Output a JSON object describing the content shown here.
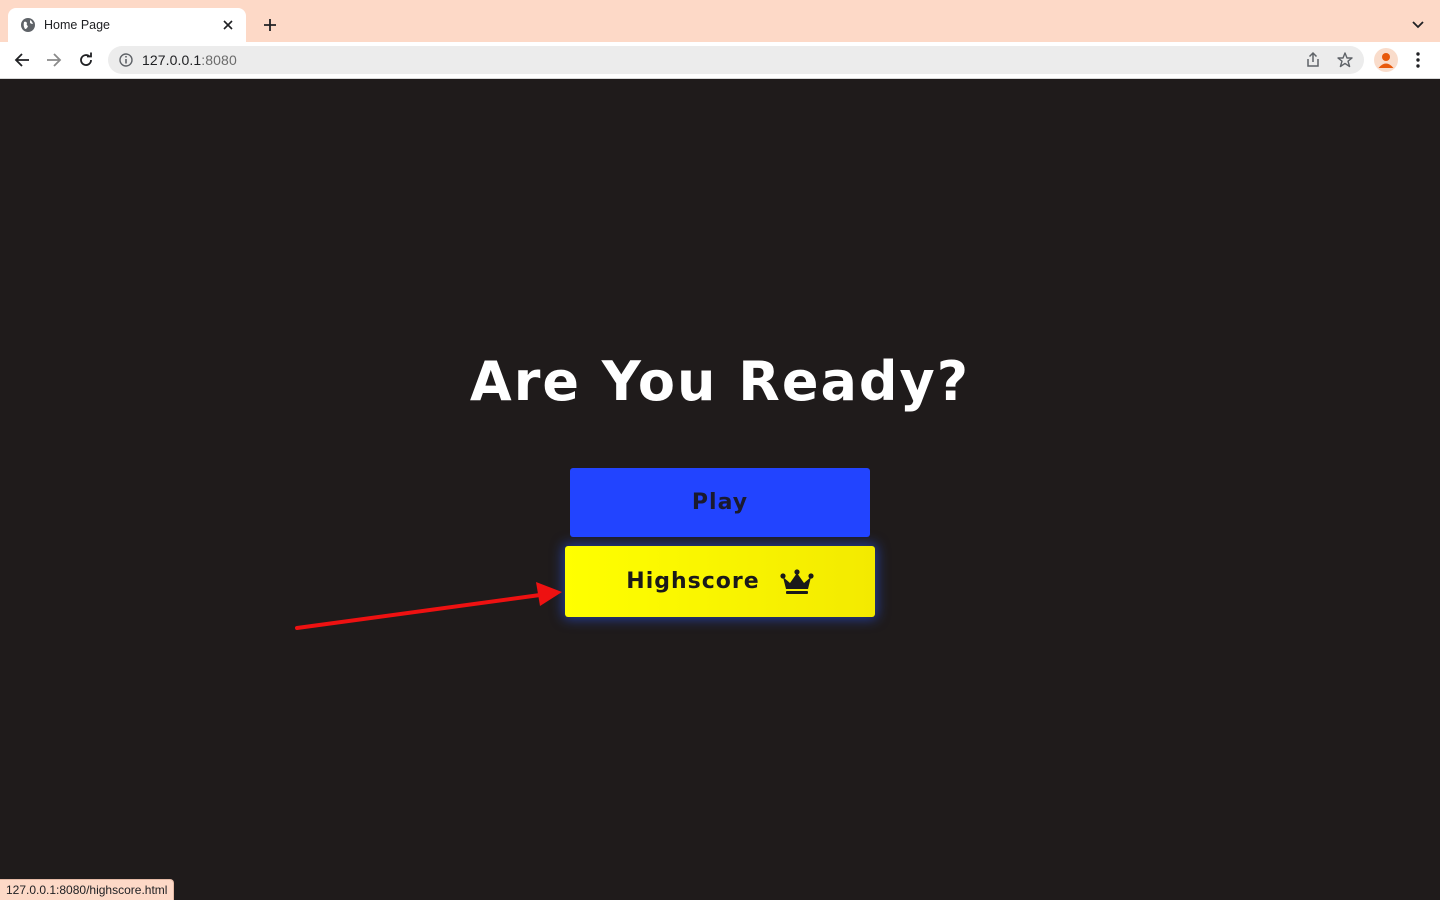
{
  "browser": {
    "tab": {
      "title": "Home Page"
    },
    "address": {
      "host": "127.0.0.1",
      "port": ":8080"
    },
    "status_url": "127.0.0.1:8080/highscore.html"
  },
  "page": {
    "heading": "Are You Ready?",
    "play_label": "Play",
    "highscore_label": "Highscore"
  },
  "colors": {
    "tabstrip": "#fdd9c7",
    "page_background": "#1f1b1b",
    "play_button": "#2244ff",
    "highscore_button": "#ffff00",
    "annotation_arrow": "#ee1111"
  },
  "icons": {
    "tab": "globe-icon",
    "close": "close-icon",
    "new_tab": "plus-icon",
    "tab_menu": "chevron-down-icon",
    "back": "back-arrow-icon",
    "forward": "forward-arrow-icon",
    "reload": "reload-icon",
    "site_info": "info-icon",
    "share": "share-icon",
    "bookmark": "star-icon",
    "profile": "avatar-icon",
    "menu": "kebab-menu-icon",
    "highscore": "crown-icon"
  }
}
